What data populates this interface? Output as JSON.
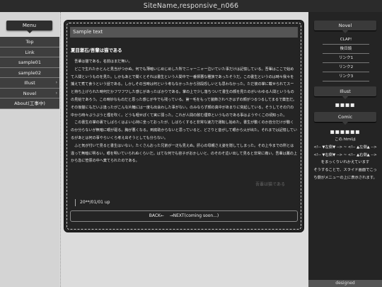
{
  "site_title": "SiteName,responsive_n066",
  "menu": {
    "header": "Menu",
    "items": [
      {
        "label": "Top",
        "has_arrow": false
      },
      {
        "label": "Link",
        "has_arrow": false
      },
      {
        "label": "sample01",
        "has_arrow": false
      },
      {
        "label": "sample02",
        "has_arrow": false
      },
      {
        "label": "Illust",
        "has_arrow": true
      },
      {
        "label": "Novel",
        "has_arrow": true
      },
      {
        "label": "About(工事中)",
        "has_arrow": false
      }
    ],
    "arrow_glyph": "›"
  },
  "main": {
    "sample_label": "Sample text",
    "heading": "夏目漱石/吾輩は猫である",
    "body": "　吾輩は猫である。名前はまだ無い。\n　どこで生れたかとんと見当がつかぬ。何でも薄暗いじめじめした所でニャーニャー泣いていた事だけは記憶している。吾輩はここで始めて人間というものを見た。しかもあとで聞くとそれは書生という人間中で一番獰悪な種族であったそうだ。この書生というのは時々我々を捕えて煮て食うという話である。しかしその当時は何という考もなかったから別段恐しいとも思わなかった。ただ彼の掌に載せられてスーと持ち上げられた時何だかフワフワした感じがあったばかりである。掌の上で少し落ちついて書生の顔を見たのがいわゆる人間というものの見始であろう。この時妙なものだと思った感じが今でも残っている。第一毛をもって装飾されべきはずの顔がつるつるしてまるで薬缶だ。その後猫にもだいぶ逢ったがこんな片輪には一度も出会わした事がない。のみならず顔の真中があまりに突起している。そうしてその穴の中から時々ぷうぷうと煙を吹く。どうも咽せぽくて実に弱った。これが人間の飲む煙草というものである事はようやくこの頃知った。\n　この書生の掌の裏でしばらくはよい心持に坐っておったが、しばらくすると非常な速力で運転し始めた。書生が動くのか自分だけが動くのか分らないが無暗に眼が廻る。胸が悪くなる。到底助からないと思っていると、どさりと音がして眼から火が出た。それまでは記憶しているがあとは何の事やらいくら考え出そうとしても分らない。\n　ふと気が付いて見ると書生はいない。たくさんおった兄弟が一疋も見えぬ。肝心の母親さえ姿を隠してしまった。その上今までの所とは違って無暗に明るい。眼を明いていられぬくらいだ。はてな何でも容子がおかしいと、のそのそ這い出して見ると非常に痛い。吾輩は藁の上から急に笹原の中へ棄てられたのである。",
    "signature": "吾輩は猫である",
    "date": "20**/01/01 up",
    "nav_back": "BACK←",
    "nav_next": "→NEXT(coming soon...)"
  },
  "right": {
    "novel_header": "Novel",
    "links": [
      "CLAP!",
      "後日談",
      "リンク1",
      "リンク2",
      "リンク3"
    ],
    "illust_header": "Illust",
    "illust_dots": "■■■■",
    "comic_header": "Comic",
    "comic_dots": "■■■■■■",
    "comic_text": "この.htmlは\n<!-- ▼左側▼ --> ~ <!-- ▲左側▲ -->\n<!-- ▼右側▼ --> ~ <!-- ▲右側▲ -->\nをまっくりいれかえています\nそうすることで、スライド画面でこっち側がメニューの上に表示されます。"
  },
  "footer": "designed"
}
